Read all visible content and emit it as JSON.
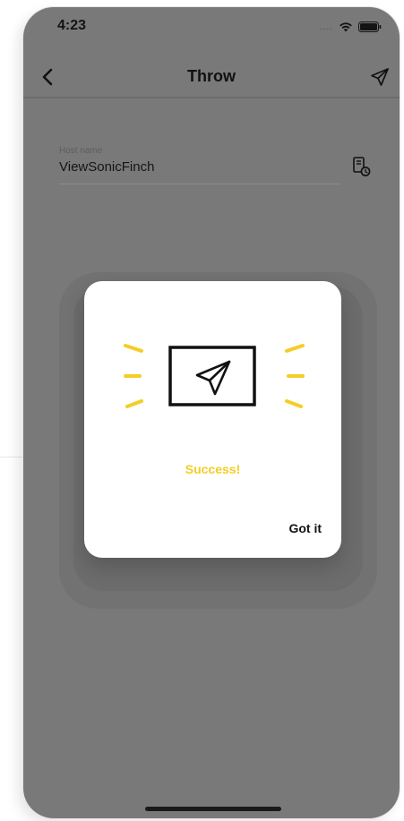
{
  "status_bar": {
    "time": "4:23",
    "signal": "....",
    "icons": [
      "wifi-icon",
      "battery-icon"
    ]
  },
  "nav": {
    "title": "Throw",
    "back_icon": "chevron-left-icon",
    "action_icon": "paper-plane-icon"
  },
  "form": {
    "host_label": "Host name",
    "host_value": "ViewSonicFinch",
    "history_icon": "device-history-icon"
  },
  "dialog": {
    "illustration_icon": "screen-paper-plane-icon",
    "success_text": "Success!",
    "confirm_label": "Got it"
  },
  "colors": {
    "overlay": "#797979",
    "dialog_bg": "#ffffff",
    "accent": "#f5cd25",
    "text": "#111111"
  }
}
